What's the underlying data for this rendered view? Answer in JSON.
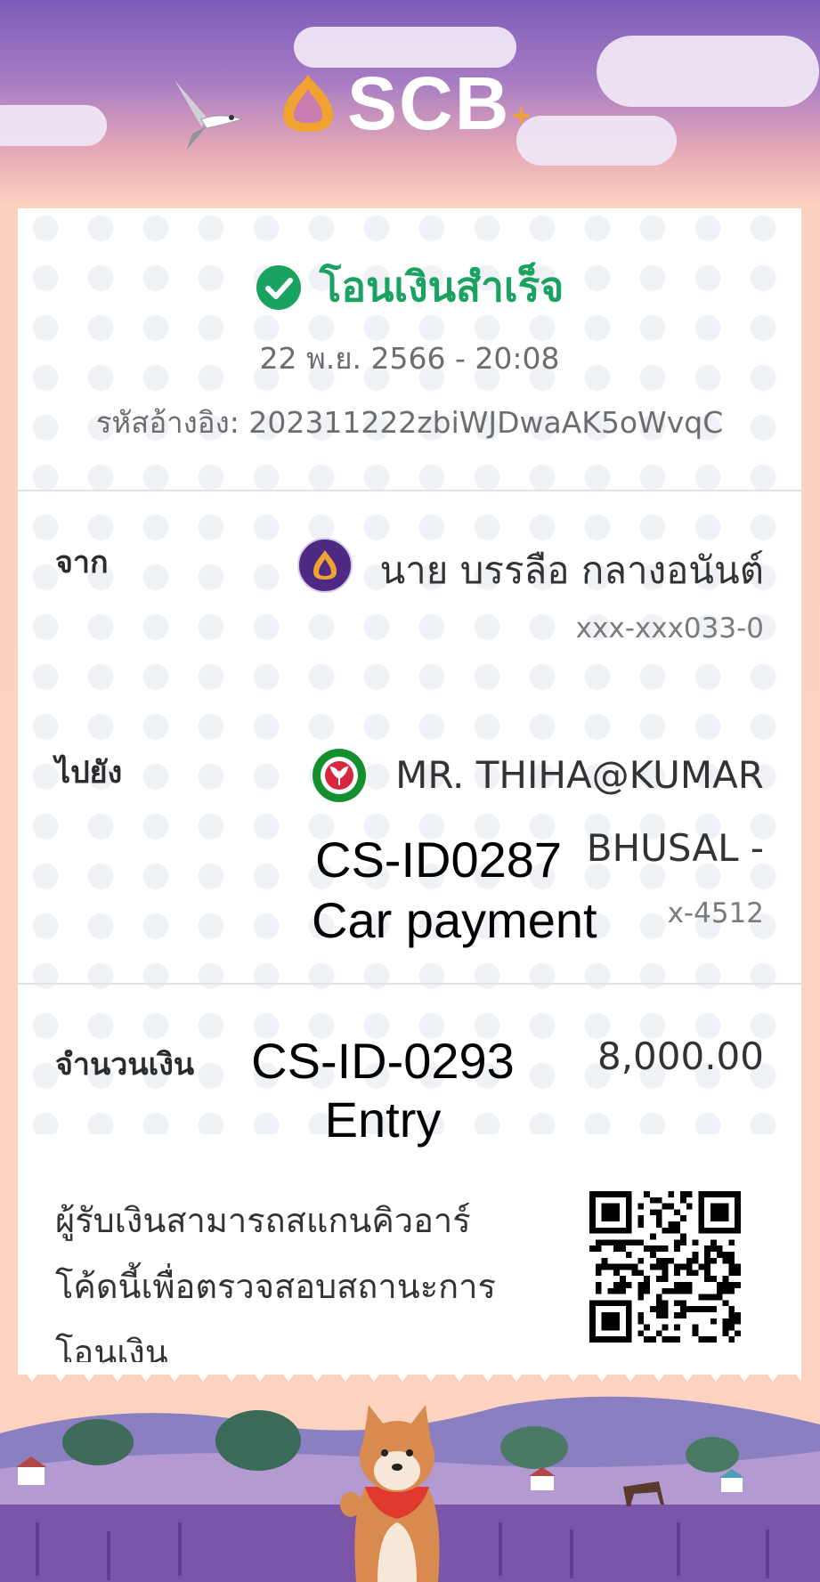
{
  "brand": {
    "name": "SCB",
    "plus": "+"
  },
  "status": {
    "text": "โอนเงินสำเร็จ",
    "icon": "check-circle-icon"
  },
  "datetime": "22 พ.ย. 2566 - 20:08",
  "reference": {
    "label": "รหัสอ้างอิง:",
    "value": "202311222zbiWJDwaAK5oWvqC"
  },
  "from": {
    "label": "จาก",
    "name": "นาย บรรลือ กลางอนันต์",
    "account": "xxx-xxx033-0",
    "icon": "scb-bank-icon"
  },
  "to": {
    "label": "ไปยัง",
    "name_line1": "MR. THIHA@KUMAR",
    "name_line2": "BHUSAL -",
    "account": "x-4512",
    "icon": "kbank-icon"
  },
  "amount": {
    "label": "จำนวนเงิน",
    "value": "8,000.00"
  },
  "overlays": {
    "to_line1": "CS-ID0287",
    "to_line2": "Car payment",
    "amount_line1": "CS-ID-0293",
    "amount_line2": "Entry"
  },
  "qr": {
    "line1": "ผู้รับเงินสามารถสแกนคิวอาร์",
    "line2": "โค้ดนี้เพื่อตรวจสอบสถานะการ",
    "line3": "โอนเงิน",
    "icon": "qr-code-icon"
  },
  "colors": {
    "success": "#1aa260",
    "brand_purple": "#4e2a84",
    "brand_gold": "#f0a330",
    "kbank_green": "#138f2d"
  }
}
